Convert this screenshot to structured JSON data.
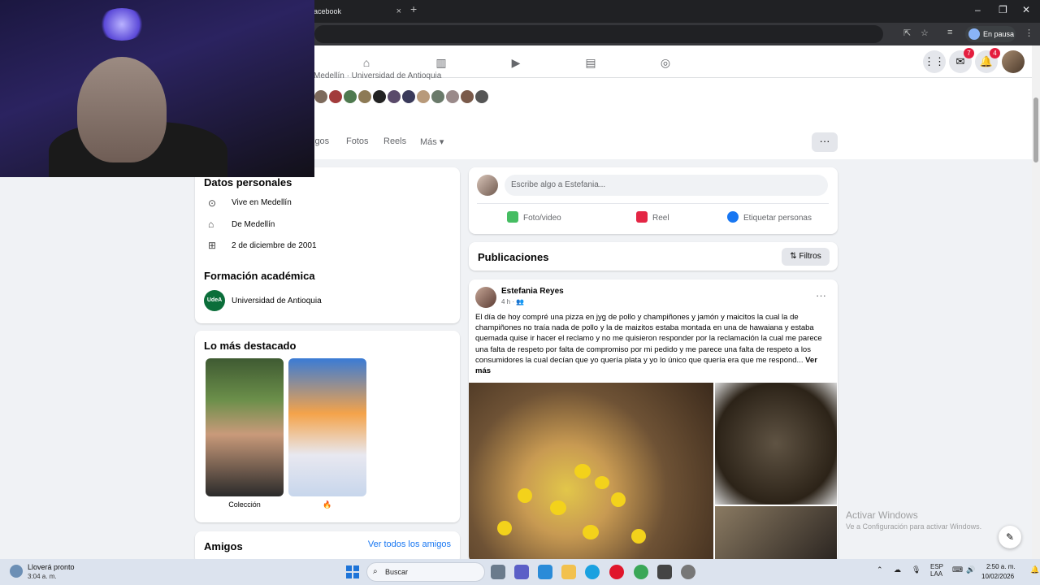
{
  "browser": {
    "tab_title": "acebook",
    "tab_close": "×",
    "new_tab": "+",
    "profile_status": "En pausa",
    "window_controls": [
      "–",
      "❐",
      "✕"
    ]
  },
  "fb_nav": {
    "messenger_badge": "7",
    "notifications_badge": "4",
    "icons": [
      "home-icon",
      "dashboard-icon",
      "video-icon",
      "marketplace-icon",
      "groups-icon",
      "menu-grid-icon",
      "messenger-icon",
      "bell-icon"
    ]
  },
  "profile": {
    "breadcrumb": "Medellín · Universidad de Antioquia",
    "tabs": [
      "igos",
      "Fotos",
      "Reels",
      "Más ▾"
    ],
    "more_label": "···"
  },
  "personal_data": {
    "title": "Datos personales",
    "rows": [
      {
        "icon": "location-icon",
        "text": "Vive en Medellín"
      },
      {
        "icon": "home-icon",
        "text": "De Medellín"
      },
      {
        "icon": "cake-icon",
        "text": "2 de diciembre de 2001"
      }
    ]
  },
  "education": {
    "title": "Formación académica",
    "logo_text": "UdeA",
    "school": "Universidad de Antioquia"
  },
  "highlights": {
    "title": "Lo más destacado",
    "items": [
      {
        "label": "Colección"
      },
      {
        "label": "🔥"
      }
    ]
  },
  "friends": {
    "title": "Amigos",
    "see_all": "Ver todos los amigos"
  },
  "composer": {
    "placeholder": "Escribe algo a Estefania...",
    "actions": [
      "Foto/video",
      "Reel",
      "Etiquetar personas"
    ]
  },
  "publications": {
    "title": "Publicaciones",
    "filters": "Filtros"
  },
  "post": {
    "author": "Estefania Reyes",
    "time": "4 h ·",
    "text": "El día de hoy compré una pizza en jyg de pollo y champiñones y jamón y maicitos la cual la de champiñones no traía nada de pollo y la de maizitos estaba montada en una de hawaiana y estaba quemada quise ir hacer el reclamo y no me quisieron responder por la reclamación la cual me parece una falta de respeto por falta de compromiso por mi pedido y me parece una falta de respeto a los consumidores la cual decían que yo quería plata y yo lo único que quería era que me respond...",
    "see_more": "Ver más"
  },
  "watermark": {
    "line1": "Activar Windows",
    "line2": "Ve a Configuración para activar Windows."
  },
  "taskbar": {
    "weather_title": "Lloverá pronto",
    "weather_time": "3:04 a. m.",
    "search": "Buscar",
    "lang1": "ESP",
    "lang2": "LAA",
    "clock_time": "2:50 a. m.",
    "clock_date": "10/02/2026"
  }
}
